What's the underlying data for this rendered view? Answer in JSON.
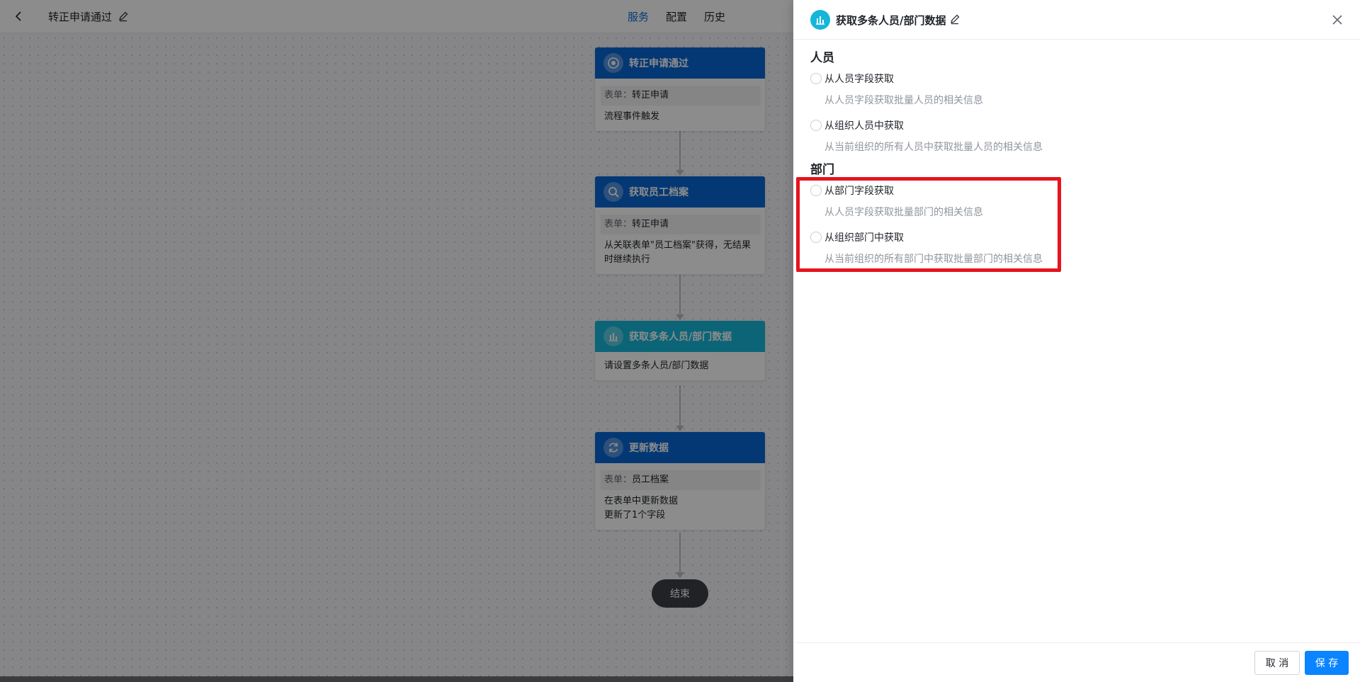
{
  "topbar": {
    "flow_title": "转正申请通过",
    "tabs": [
      "服务",
      "配置",
      "历史"
    ],
    "active_tab": 0
  },
  "nodes": [
    {
      "title": "转正申请通过",
      "icon": "target-icon",
      "form_label": "表单：",
      "form_value": "转正申请",
      "lines": [
        "流程事件触发"
      ]
    },
    {
      "title": "获取员工档案",
      "icon": "search-icon",
      "form_label": "表单：",
      "form_value": "转正申请",
      "lines": [
        "从关联表单\"员工档案\"获得，无结果时继续执行"
      ]
    },
    {
      "title": "获取多条人员/部门数据",
      "icon": "bar-chart-icon",
      "lines": [
        "请设置多条人员/部门数据"
      ]
    },
    {
      "title": "更新数据",
      "icon": "refresh-icon",
      "form_label": "表单：",
      "form_value": "员工档案",
      "lines": [
        "在表单中更新数据",
        "更新了1个字段"
      ]
    }
  ],
  "end_label": "结束",
  "drawer": {
    "title": "获取多条人员/部门数据",
    "sections": [
      {
        "title": "人员",
        "options": [
          {
            "label": "从人员字段获取",
            "desc": "从人员字段获取批量人员的相关信息"
          },
          {
            "label": "从组织人员中获取",
            "desc": "从当前组织的所有人员中获取批量人员的相关信息"
          }
        ]
      },
      {
        "title": "部门",
        "options": [
          {
            "label": "从部门字段获取",
            "desc": "从人员字段获取批量部门的相关信息"
          },
          {
            "label": "从组织部门中获取",
            "desc": "从当前组织的所有部门中获取批量部门的相关信息"
          }
        ]
      }
    ],
    "cancel_label": "取 消",
    "save_label": "保 存"
  },
  "colors": {
    "node_blue": "#0966d4",
    "node_cyan": "#16b6d9",
    "primary": "#0a84ff",
    "highlight": "#e5141e"
  }
}
